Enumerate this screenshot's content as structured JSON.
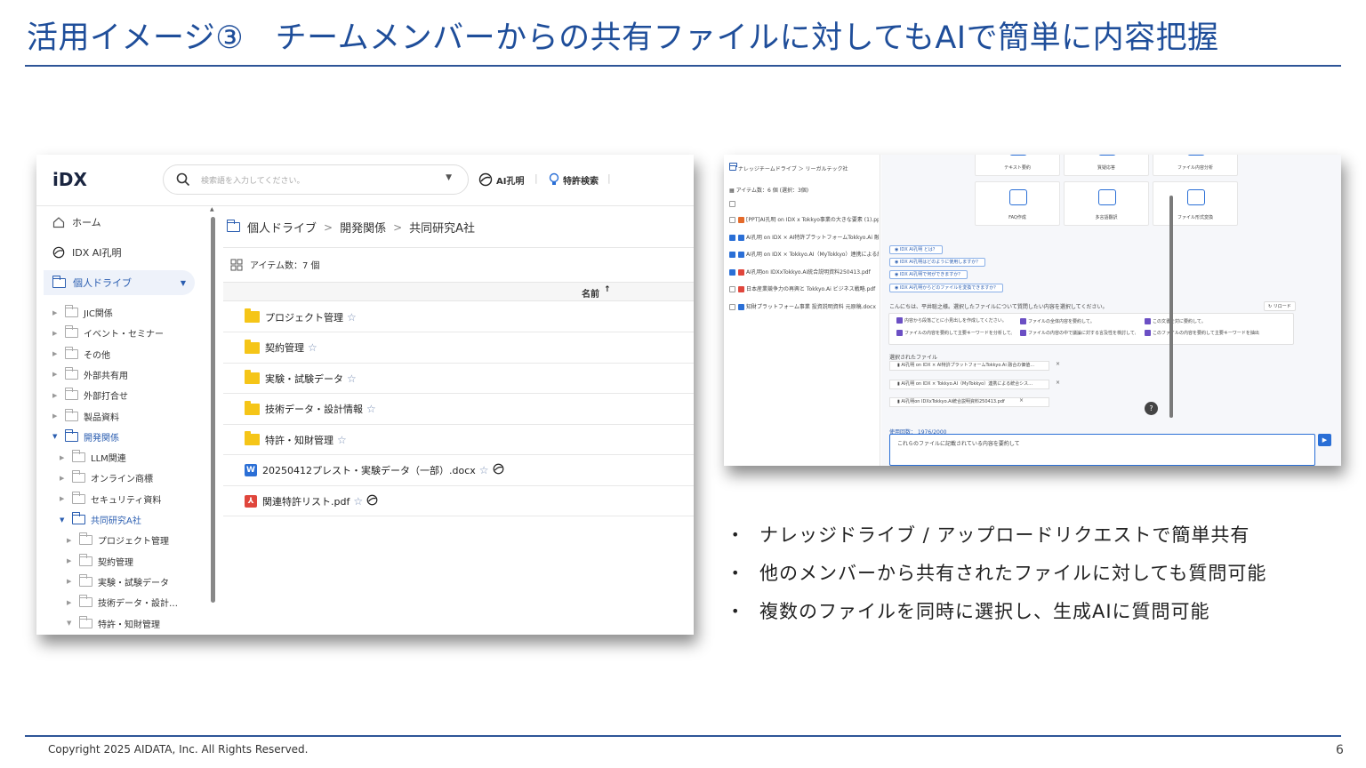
{
  "slide": {
    "title": "活用イメージ③　チームメンバーからの共有ファイルに対してもAIで簡単に内容把握",
    "copyright": "Copyright 2025 AIDATA, Inc. All Rights Reserved.",
    "page_number": "6",
    "bullets": [
      "ナレッジドライブ / アップロードリクエストで簡単共有",
      "他のメンバーから共有されたファイルに対しても質問可能",
      "複数のファイルを同時に選択し、生成AIに質問可能"
    ]
  },
  "shot1": {
    "logo": "iDX",
    "search_placeholder": "検索語を入力してください。",
    "header_ai": "AI孔明",
    "header_patent": "特許検索",
    "nav": {
      "home": "ホーム",
      "ai": "IDX AI孔明",
      "personal_drive": "個人ドライブ"
    },
    "tree": [
      {
        "label": "JIC関係",
        "level": 0,
        "open": false,
        "active": false
      },
      {
        "label": "イベント・セミナー",
        "level": 0,
        "open": false,
        "active": false
      },
      {
        "label": "その他",
        "level": 0,
        "open": false,
        "active": false
      },
      {
        "label": "外部共有用",
        "level": 0,
        "open": false,
        "active": false
      },
      {
        "label": "外部打合せ",
        "level": 0,
        "open": false,
        "active": false
      },
      {
        "label": "製品資料",
        "level": 0,
        "open": false,
        "active": false
      },
      {
        "label": "開発関係",
        "level": 0,
        "open": true,
        "active": true
      },
      {
        "label": "LLM関連",
        "level": 1,
        "open": false,
        "active": false
      },
      {
        "label": "オンライン商標",
        "level": 1,
        "open": false,
        "active": false
      },
      {
        "label": "セキュリティ資料",
        "level": 1,
        "open": false,
        "active": false
      },
      {
        "label": "共同研究A社",
        "level": 1,
        "open": true,
        "active": true
      },
      {
        "label": "プロジェクト管理",
        "level": 2,
        "open": false,
        "active": false
      },
      {
        "label": "契約管理",
        "level": 2,
        "open": false,
        "active": false
      },
      {
        "label": "実験・試験データ",
        "level": 2,
        "open": false,
        "active": false
      },
      {
        "label": "技術データ・設計…",
        "level": 2,
        "open": false,
        "active": false
      },
      {
        "label": "特許・知財管理",
        "level": 2,
        "open": true,
        "active": false
      }
    ],
    "breadcrumb": [
      "個人ドライブ",
      "開発関係",
      "共同研究A社"
    ],
    "item_count": "アイテム数：7 個",
    "column_name": "名前",
    "files": [
      {
        "name": "プロジェクト管理",
        "type": "folder",
        "ai": false
      },
      {
        "name": "契約管理",
        "type": "folder",
        "ai": false
      },
      {
        "name": "実験・試験データ",
        "type": "folder",
        "ai": false
      },
      {
        "name": "技術データ・設計情報",
        "type": "folder",
        "ai": false
      },
      {
        "name": "特許・知財管理",
        "type": "folder",
        "ai": false
      },
      {
        "name": "20250412プレスト・実験データ（一部）.docx",
        "type": "word",
        "ai": true
      },
      {
        "name": "関連特許リスト.pdf",
        "type": "pdf",
        "ai": true
      }
    ]
  },
  "shot2": {
    "breadcrumb": "ナレッジチームドライブ ＞ リーガルテック社",
    "item_count": "アイテム数：6 個 (選択：3個)",
    "files": [
      {
        "name": "[PPT]AI孔明 on IDX x Tokkyo事業の大きな要素 (1).pptx",
        "checked": false,
        "type": "o"
      },
      {
        "name": "AI孔明 on IDX × AI特許プラットフォームTokkyo.Ai 融合の価値",
        "checked": true,
        "type": "w"
      },
      {
        "name": "AI孔明 on IDX × Tokkyo.AI（MyTokkyo）連携による統合システム",
        "checked": true,
        "type": "w"
      },
      {
        "name": "AI孔明on IDXxTokkyo.Ai統合説明資料250413.pdf",
        "checked": true,
        "type": "p"
      },
      {
        "name": "日本産業競争力の再興と Tokkyo.Ai ビジネス戦略.pdf",
        "checked": false,
        "type": "p"
      },
      {
        "name": "知財プラットフォーム事業 投資説明資料 元原稿.docx",
        "checked": false,
        "type": "w"
      }
    ],
    "tools": [
      "テキスト要約",
      "質疑応答",
      "ファイル内容分析",
      "FAQ作成",
      "多言語翻訳",
      "ファイル形式変換"
    ],
    "chips": [
      "IDX AI孔明 とは？",
      "IDX AI孔明はどのように使用しますか？",
      "IDX AI孔明で何ができますか？",
      "IDX AI孔明からどのファイルを変換できますか？"
    ],
    "greeting": "こんにちは、平井聡之様。選択したファイルについて質問したい内容を選択してください。",
    "reload": "リロード",
    "suggestions": [
      "内容から段落ごとに小見出しを作成してください。",
      "ファイルの全体内容を要約して。",
      "この文書を対に要約して。",
      "ファイルの内容を要約して主要キーワードを分析して。",
      "ファイルの内容の中で議論に対する言及性を検討して。",
      "このファイルの内容を要約して主要キーワードを抽出して。"
    ],
    "selected_label": "選択されたファイル",
    "selected_files": [
      "AI孔明 on IDX × AI特許プラットフォームTokkyo.Ai 融合の価値…",
      "AI孔明 on IDX × Tokkyo.AI（MyTokkyo）連携による統合シス…",
      "AI孔明on IDXxTokkyo.Ai統合説明資料250413.pdf"
    ],
    "usage": "使用回数： 1976/2000",
    "input_text": "これらのファイルに記載されている内容を要約して"
  }
}
